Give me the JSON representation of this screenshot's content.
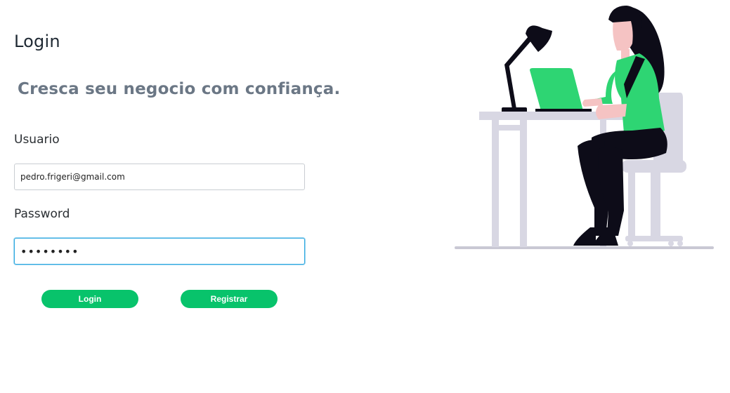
{
  "page": {
    "title": "Login",
    "subtitle": "Cresca seu negocio com confiança."
  },
  "form": {
    "user_label": "Usuario",
    "user_value": "pedro.frigeri@gmail.com",
    "password_label": "Password",
    "password_value": "********",
    "login_button": "Login",
    "register_button": "Registrar"
  },
  "colors": {
    "accent": "#08c36b",
    "focus_border": "#2fa9e0",
    "subtitle": "#6b7785",
    "illustration_green": "#2ed573",
    "illustration_gray": "#d8d7e3",
    "illustration_dark": "#0d0c18"
  },
  "illustration": {
    "icon": "woman-at-laptop-illustration"
  }
}
